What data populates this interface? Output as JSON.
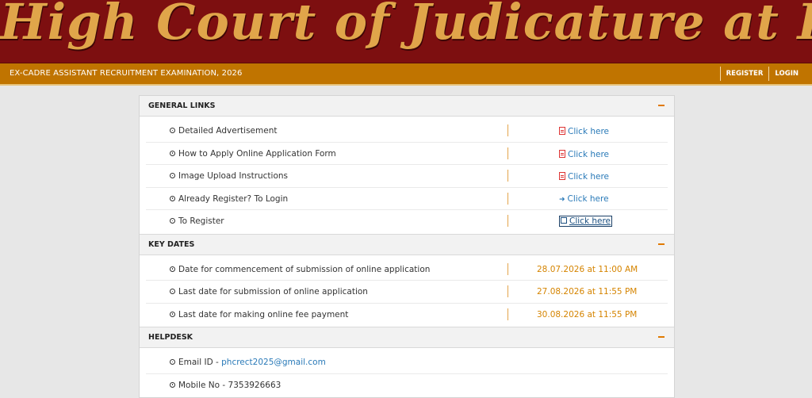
{
  "banner": {
    "title": "High Court of Judicature at Patna"
  },
  "navbar": {
    "exam_title": "EX-CADRE ASSISTANT RECRUITMENT EXAMINATION, 2026",
    "register_label": "REGISTER",
    "login_label": "LOGIN"
  },
  "sections": {
    "general": {
      "title": "GENERAL LINKS",
      "rows": [
        {
          "label": "Detailed Advertisement",
          "link": "Click here",
          "icon": "pdf-icon"
        },
        {
          "label": "How to Apply Online Application Form",
          "link": "Click here",
          "icon": "pdf-icon"
        },
        {
          "label": "Image Upload Instructions",
          "link": "Click here",
          "icon": "pdf-icon"
        },
        {
          "label": "Already Register? To Login",
          "link": "Click here",
          "icon": "login-icon"
        },
        {
          "label": "To Register",
          "link": "Click here",
          "icon": "edit-icon"
        }
      ]
    },
    "key_dates": {
      "title": "KEY DATES",
      "rows": [
        {
          "label": "Date for commencement of submission of online application",
          "value": "28.07.2026 at 11:00 AM"
        },
        {
          "label": "Last date for submission of online application",
          "value": "27.08.2026 at 11:55 PM"
        },
        {
          "label": "Last date for making online fee payment",
          "value": "30.08.2026 at 11:55 PM"
        }
      ]
    },
    "helpdesk": {
      "title": "HELPDESK",
      "email_label": "Email ID - ",
      "email": "phcrect2025@gmail.com",
      "mobile": "Mobile No - 7353926663"
    }
  },
  "colors": {
    "banner_bg": "#7d0f10",
    "navbar_bg": "#c07400",
    "accent": "#e07a00",
    "link": "#2a7ab8",
    "date": "#d58400"
  }
}
